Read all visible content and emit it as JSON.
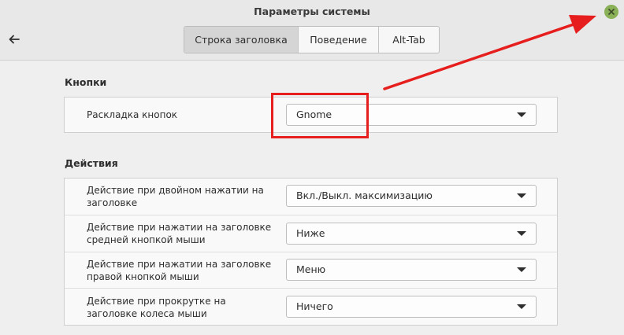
{
  "window": {
    "title": "Параметры системы",
    "icons": {
      "close": "close-icon",
      "back": "back-arrow-icon"
    }
  },
  "tabs": [
    {
      "label": "Строка заголовка",
      "active": true
    },
    {
      "label": "Поведение",
      "active": false
    },
    {
      "label": "Alt-Tab",
      "active": false
    }
  ],
  "buttons_section": {
    "title": "Кнопки",
    "rows": [
      {
        "label": "Раскладка кнопок",
        "value": "Gnome"
      }
    ]
  },
  "actions_section": {
    "title": "Действия",
    "rows": [
      {
        "label": "Действие при двойном нажатии на заголовке",
        "value": "Вкл./Выкл. максимизацию"
      },
      {
        "label": "Действие при нажатии на заголовке средней кнопкой мыши",
        "value": "Ниже"
      },
      {
        "label": "Действие при нажатии на заголовке правой кнопкой мыши",
        "value": "Меню"
      },
      {
        "label": "Действие при прокрутке на заголовке колеса мыши",
        "value": "Ничего"
      }
    ]
  },
  "colors": {
    "annotation": "#e61e1e",
    "close_button": "#8bb158",
    "active_tab": "#d5d5d5"
  }
}
